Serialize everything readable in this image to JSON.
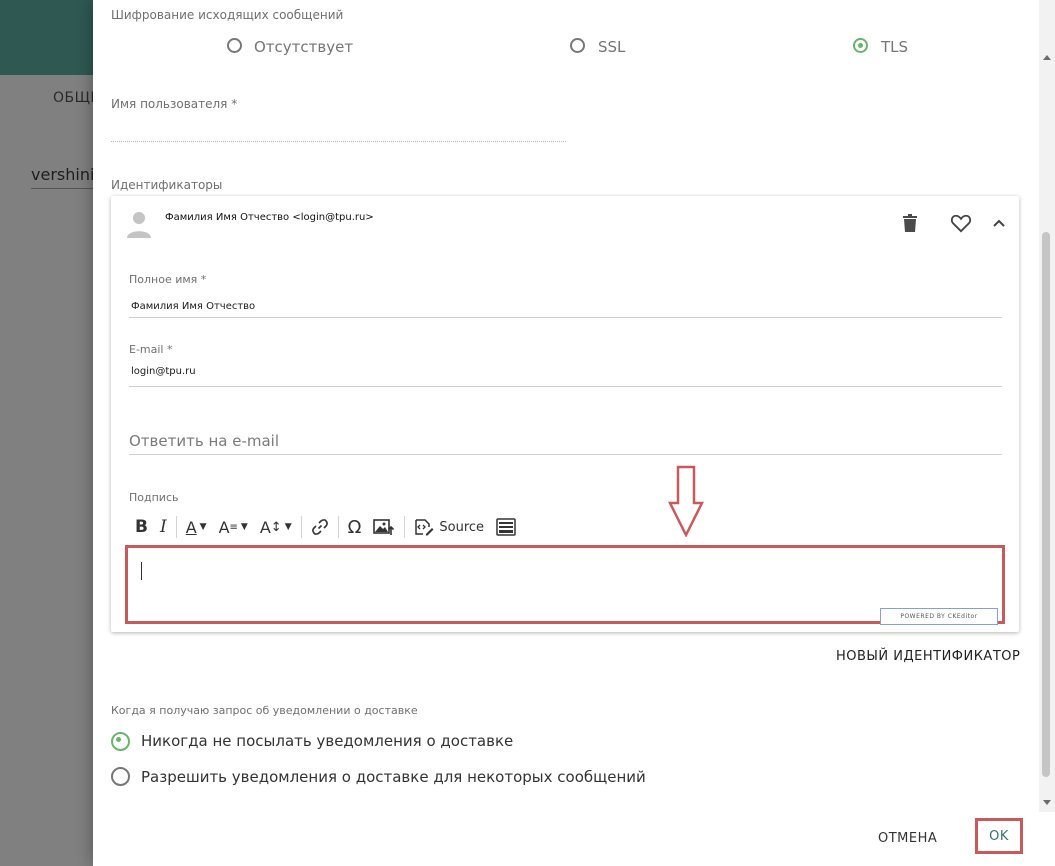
{
  "background": {
    "tab_label": "ОБЩЕ",
    "user_name": "vershinir"
  },
  "encryption": {
    "label": "Шифрование исходящих сообщений",
    "options": [
      "Отсутствует",
      "SSL",
      "TLS"
    ],
    "selected": "TLS"
  },
  "username": {
    "label": "Имя пользователя *",
    "value": ""
  },
  "identities": {
    "label": "Идентификаторы",
    "card": {
      "title": "Фамилия Имя Отчество <login@tpu.ru>",
      "full_name_label": "Полное имя *",
      "full_name_value": "Фамилия Имя Отчество",
      "email_label": "E-mail *",
      "email_value": "login@tpu.ru",
      "reply_to_placeholder": "Ответить на e-mail",
      "signature_label": "Подпись",
      "toolbar": {
        "bold": "B",
        "italic": "I",
        "font_color": "A",
        "font_family": "A",
        "font_size": "A",
        "special_char": "Ω",
        "source_label": "Source"
      },
      "ck_badge": "POWERED BY CKEditor"
    },
    "new_identity_button": "НОВЫЙ ИДЕНТИФИКАТОР"
  },
  "delivery": {
    "label": "Когда я получаю запрос об уведомлении о доставке",
    "options": [
      "Никогда не посылать уведомления о доставке",
      "Разрешить уведомления о доставке для некоторых сообщений"
    ],
    "selected_index": 0
  },
  "footer": {
    "cancel_label": "ОТМЕНА",
    "ok_label": "OK"
  },
  "colors": {
    "accent_green": "#6bb36b",
    "header_teal": "#2f5853",
    "annotation_red": "#c75a5d"
  }
}
